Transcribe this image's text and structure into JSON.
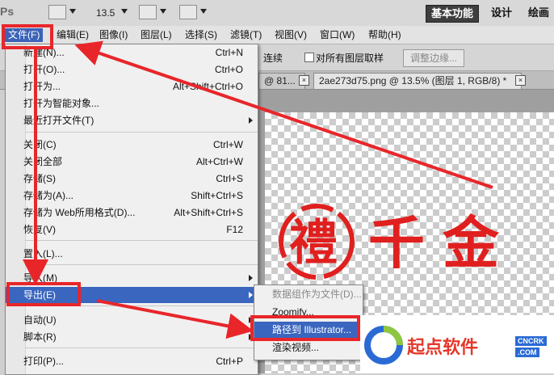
{
  "topbar": {
    "app_logo": "Ps",
    "zoom": "13.5",
    "workspaces": [
      "基本功能",
      "设计",
      "绘画"
    ]
  },
  "menubar": {
    "items": [
      "文件(F)",
      "编辑(E)",
      "图像(I)",
      "图层(L)",
      "选择(S)",
      "滤镜(T)",
      "视图(V)",
      "窗口(W)",
      "帮助(H)"
    ]
  },
  "options": {
    "contiguous": "连续",
    "sample_all_layers": "对所有图层取样",
    "refine_edge": "调整边缘..."
  },
  "tabs": {
    "tab1": "@ 81...",
    "tab2": "2ae273d75.png @ 13.5% (图层 1, RGB/8) *"
  },
  "file_menu": {
    "items": [
      {
        "label": "新建(N)...",
        "shortcut": "Ctrl+N"
      },
      {
        "label": "打开(O)...",
        "shortcut": "Ctrl+O"
      },
      {
        "label": "打开为...",
        "shortcut": "Alt+Shift+Ctrl+O"
      },
      {
        "label": "打开为智能对象...",
        "shortcut": ""
      },
      {
        "label": "最近打开文件(T)",
        "shortcut": ""
      },
      {
        "label": "关闭(C)",
        "shortcut": "Ctrl+W"
      },
      {
        "label": "关闭全部",
        "shortcut": "Alt+Ctrl+W"
      },
      {
        "label": "存储(S)",
        "shortcut": "Ctrl+S"
      },
      {
        "label": "存储为(A)...",
        "shortcut": "Shift+Ctrl+S"
      },
      {
        "label": "存储为 Web所用格式(D)...",
        "shortcut": "Alt+Shift+Ctrl+S"
      },
      {
        "label": "恢复(V)",
        "shortcut": "F12"
      },
      {
        "label": "置入(L)...",
        "shortcut": ""
      },
      {
        "label": "导入(M)",
        "shortcut": ""
      },
      {
        "label": "导出(E)",
        "shortcut": ""
      },
      {
        "label": "自动(U)",
        "shortcut": ""
      },
      {
        "label": "脚本(R)",
        "shortcut": ""
      },
      {
        "label": "打印(P)...",
        "shortcut": "Ctrl+P"
      }
    ]
  },
  "export_submenu": {
    "items": [
      "数据组作为文件(D)...",
      "Zoomify...",
      "路径到 Illustrator...",
      "渲染视频..."
    ]
  },
  "canvas_art": {
    "chars": [
      "禮",
      "千",
      "金"
    ]
  },
  "watermark": {
    "text": "起点软件",
    "domain": "CNCRK",
    "com": ".COM"
  },
  "colors": {
    "highlight": "#3b66bf",
    "annotation_red": "#e8262a",
    "art_red": "#e0201f"
  }
}
